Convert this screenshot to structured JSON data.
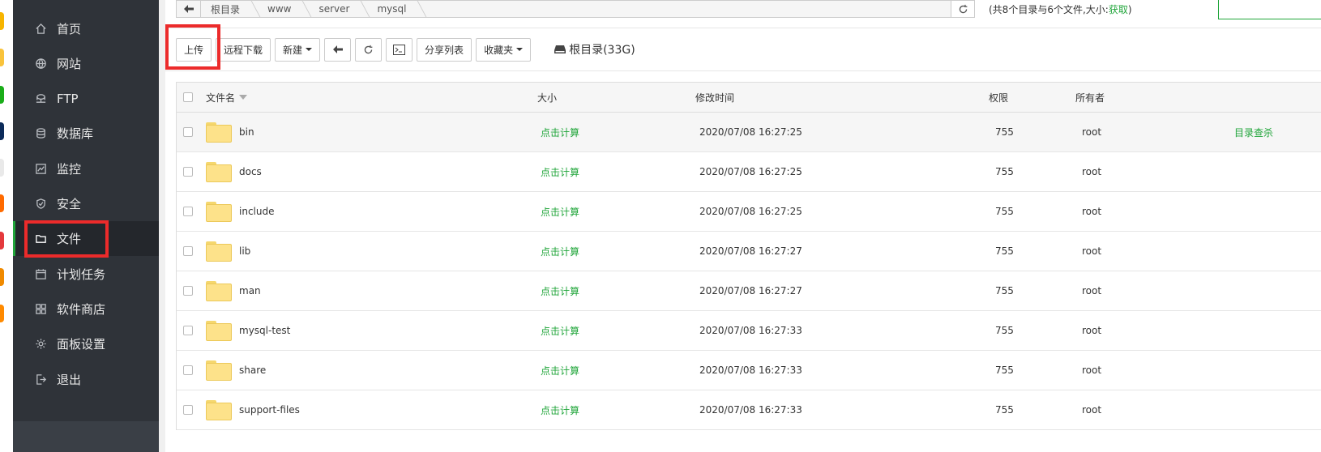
{
  "app_strip_colors": [
    "#f7b500",
    "#f9c33b",
    "#1aad19",
    "#0c2b5a",
    "#e9e9e9",
    "#ff6a00",
    "#e4393c",
    "#f08a00",
    "#ff8a00"
  ],
  "sidebar": {
    "items": [
      {
        "label": "首页",
        "icon": "home-icon"
      },
      {
        "label": "网站",
        "icon": "globe-icon"
      },
      {
        "label": "FTP",
        "icon": "ftp-icon"
      },
      {
        "label": "数据库",
        "icon": "database-icon"
      },
      {
        "label": "监控",
        "icon": "monitor-icon"
      },
      {
        "label": "安全",
        "icon": "shield-icon"
      },
      {
        "label": "文件",
        "icon": "folder-icon",
        "active": true
      },
      {
        "label": "计划任务",
        "icon": "calendar-icon"
      },
      {
        "label": "软件商店",
        "icon": "grid-icon"
      },
      {
        "label": "面板设置",
        "icon": "gear-icon"
      },
      {
        "label": "退出",
        "icon": "logout-icon"
      }
    ]
  },
  "path": {
    "crumbs": [
      "根目录",
      "www",
      "server",
      "mysql"
    ],
    "summary_text": "(共8个目录与6个文件,大小:",
    "summary_link": "获取",
    "summary_end": ")"
  },
  "toolbar": {
    "upload": "上传",
    "remote_download": "远程下载",
    "new": "新建",
    "share_list": "分享列表",
    "favorites": "收藏夹",
    "disk": "根目录(33G)"
  },
  "table": {
    "headers": {
      "name": "文件名",
      "size": "大小",
      "mtime": "修改时间",
      "perm": "权限",
      "owner": "所有者"
    },
    "rows": [
      {
        "name": "bin",
        "size": "点击计算",
        "mtime": "2020/07/08 16:27:25",
        "perm": "755",
        "owner": "root",
        "action": "目录查杀"
      },
      {
        "name": "docs",
        "size": "点击计算",
        "mtime": "2020/07/08 16:27:25",
        "perm": "755",
        "owner": "root"
      },
      {
        "name": "include",
        "size": "点击计算",
        "mtime": "2020/07/08 16:27:25",
        "perm": "755",
        "owner": "root"
      },
      {
        "name": "lib",
        "size": "点击计算",
        "mtime": "2020/07/08 16:27:27",
        "perm": "755",
        "owner": "root"
      },
      {
        "name": "man",
        "size": "点击计算",
        "mtime": "2020/07/08 16:27:27",
        "perm": "755",
        "owner": "root"
      },
      {
        "name": "mysql-test",
        "size": "点击计算",
        "mtime": "2020/07/08 16:27:33",
        "perm": "755",
        "owner": "root"
      },
      {
        "name": "share",
        "size": "点击计算",
        "mtime": "2020/07/08 16:27:33",
        "perm": "755",
        "owner": "root"
      },
      {
        "name": "support-files",
        "size": "点击计算",
        "mtime": "2020/07/08 16:27:33",
        "perm": "755",
        "owner": "root"
      }
    ]
  },
  "colors": {
    "accent": "#20a53a",
    "highlight": "#ec2b2b",
    "sidebar_bg": "#2f3339"
  }
}
